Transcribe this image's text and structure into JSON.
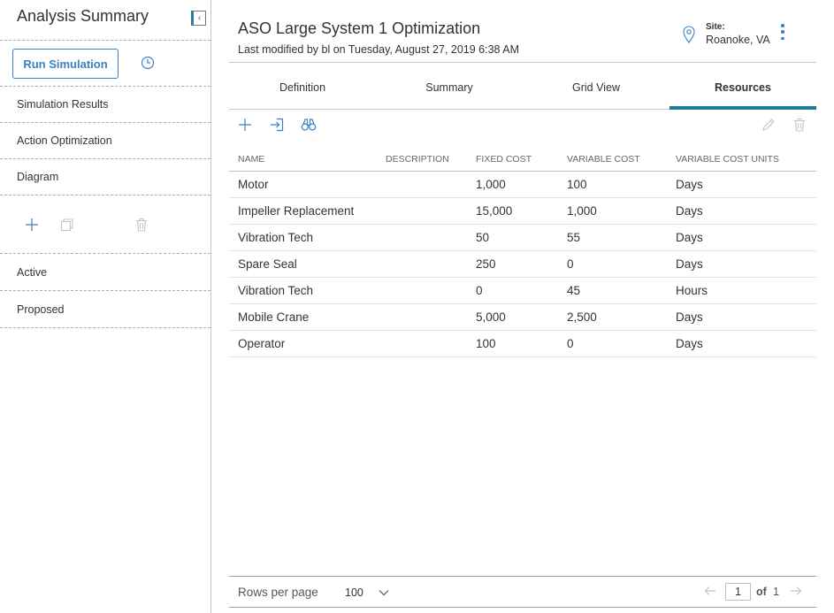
{
  "sidebar": {
    "title": "Analysis Summary",
    "collapse_icon": "chevron-left-icon",
    "run_label": "Run Simulation",
    "history_icon": "clock-icon",
    "nav": [
      {
        "label": "Simulation Results"
      },
      {
        "label": "Action Optimization"
      },
      {
        "label": "Diagram"
      }
    ],
    "tools": [
      "plus-icon",
      "copy-icon",
      "trash-icon"
    ],
    "lists": [
      {
        "label": "Active"
      },
      {
        "label": "Proposed"
      }
    ]
  },
  "header": {
    "title": "ASO Large System 1 Optimization",
    "subtitle": "Last modified by bl on Tuesday, August 27, 2019 6:38 AM",
    "site_label": "Site:",
    "site_value": "Roanoke, VA"
  },
  "tabs": [
    {
      "label": "Definition",
      "active": false
    },
    {
      "label": "Summary",
      "active": false
    },
    {
      "label": "Grid View",
      "active": false
    },
    {
      "label": "Resources",
      "active": true
    }
  ],
  "toolbar": {
    "icons": [
      "plus-icon",
      "import-icon",
      "binoculars-icon",
      "pencil-icon",
      "trash-icon"
    ]
  },
  "table": {
    "columns": [
      "NAME",
      "DESCRIPTION",
      "FIXED COST",
      "VARIABLE COST",
      "VARIABLE COST UNITS"
    ],
    "rows": [
      [
        "Motor",
        "",
        "1,000",
        "100",
        "Days"
      ],
      [
        "Impeller Replacement",
        "",
        "15,000",
        "1,000",
        "Days"
      ],
      [
        "Vibration Tech",
        "",
        "50",
        "55",
        "Days"
      ],
      [
        "Spare Seal",
        "",
        "250",
        "0",
        "Days"
      ],
      [
        "Vibration Tech",
        "",
        "0",
        "45",
        "Hours"
      ],
      [
        "Mobile Crane",
        "",
        "5,000",
        "2,500",
        "Days"
      ],
      [
        "Operator",
        "",
        "100",
        "0",
        "Days"
      ]
    ]
  },
  "pagination": {
    "rows_per_page_label": "Rows per page",
    "rows_per_page": "100",
    "current_page": "1",
    "of_label": "of",
    "total_pages": "1"
  },
  "colors": {
    "accent": "#3b80c3",
    "active_tab": "#1a7d9b",
    "disabled_icon": "#c4c4c4"
  }
}
